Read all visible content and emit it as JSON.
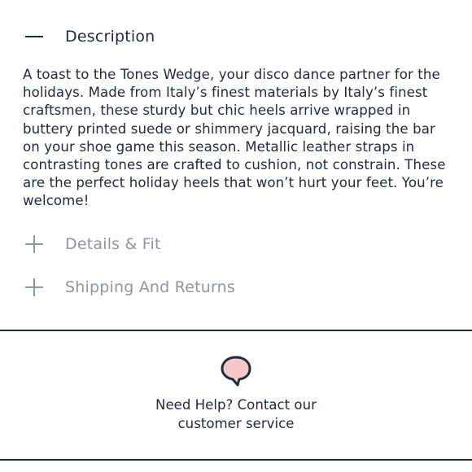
{
  "accordion": {
    "description": {
      "title": "Description",
      "state": "expanded",
      "icon": "minus-icon",
      "body": "A toast to the Tones Wedge, your disco dance partner for the holidays. Made from Italy’s finest materials by Italy’s finest craftsmen, these sturdy but chic heels arrive wrapped in buttery printed suede or shimmery jacquard, raising the bar on your shoe game this season. Metallic leather straps in contrasting tones are crafted to cushion, not constrain. These are the perfect holiday heels that won’t hurt your feet. You’re welcome!"
    },
    "details": {
      "title": "Details & Fit",
      "state": "collapsed",
      "icon": "plus-icon"
    },
    "shipping": {
      "title": "Shipping And Returns",
      "state": "collapsed",
      "icon": "plus-icon"
    }
  },
  "help": {
    "icon": "chat-bubble-icon",
    "line1": "Need Help? Contact our",
    "line2": "customer service"
  },
  "colors": {
    "text_primary": "#1c2b3d",
    "text_muted": "#8b97a3",
    "bubble_fill": "#f6c9c9",
    "divider": "#1c2b3d"
  }
}
